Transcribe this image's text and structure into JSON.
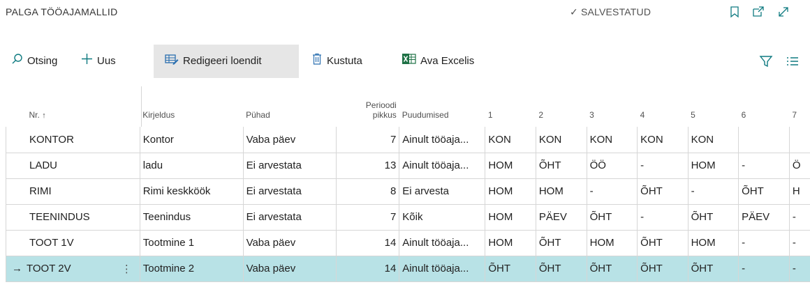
{
  "header": {
    "title": "PALGA TÖÖAJAMALLID",
    "saved_check": "✓",
    "saved_label": "SALVESTATUD"
  },
  "actions": {
    "search": "Otsing",
    "new": "Uus",
    "edit_list": "Redigeeri loendit",
    "delete": "Kustuta",
    "open_excel": "Ava Excelis"
  },
  "columns": {
    "nr": "Nr.",
    "sort_arrow": "↑",
    "description": "Kirjeldus",
    "holidays": "Pühad",
    "period_line1": "Perioodi",
    "period_line2": "pikkus",
    "absences": "Puudumised",
    "d1": "1",
    "d2": "2",
    "d3": "3",
    "d4": "4",
    "d5": "5",
    "d6": "6",
    "d7": "7"
  },
  "rows": [
    {
      "nr": "KONTOR",
      "desc": "Kontor",
      "holidays": "Vaba päev",
      "period": "7",
      "absences": "Ainult tööaja...",
      "d1": "KON",
      "d2": "KON",
      "d3": "KON",
      "d4": "KON",
      "d5": "KON",
      "d6": "",
      "d7": ""
    },
    {
      "nr": "LADU",
      "desc": "ladu",
      "holidays": "Ei arvestata",
      "period": "13",
      "absences": "Ainult tööaja...",
      "d1": "HOM",
      "d2": "ÕHT",
      "d3": "ÖÖ",
      "d4": "-",
      "d5": "HOM",
      "d6": "-",
      "d7": "Ö"
    },
    {
      "nr": "RIMI",
      "desc": "Rimi keskköök",
      "holidays": "Ei arvestata",
      "period": "8",
      "absences": "Ei arvesta",
      "d1": "HOM",
      "d2": "HOM",
      "d3": "-",
      "d4": "ÕHT",
      "d5": "-",
      "d6": "ÕHT",
      "d7": "H"
    },
    {
      "nr": "TEENINDUS",
      "desc": "Teenindus",
      "holidays": "Ei arvestata",
      "period": "7",
      "absences": "Kõik",
      "d1": "HOM",
      "d2": "PÄEV",
      "d3": "ÕHT",
      "d4": "-",
      "d5": "ÕHT",
      "d6": "PÄEV",
      "d7": "-"
    },
    {
      "nr": "TOOT 1V",
      "desc": "Tootmine 1",
      "holidays": "Vaba päev",
      "period": "14",
      "absences": "Ainult tööaja...",
      "d1": "HOM",
      "d2": "ÕHT",
      "d3": "HOM",
      "d4": "ÕHT",
      "d5": "HOM",
      "d6": "-",
      "d7": "-"
    },
    {
      "nr": "TOOT 2V",
      "desc": "Tootmine 2",
      "holidays": "Vaba päev",
      "period": "14",
      "absences": "Ainult tööaja...",
      "d1": "ÕHT",
      "d2": "ÕHT",
      "d3": "ÕHT",
      "d4": "ÕHT",
      "d5": "ÕHT",
      "d6": "-",
      "d7": "-",
      "selected": true
    }
  ],
  "selection": {
    "arrow": "→",
    "menu_dots": "⋮"
  },
  "icons": [
    "search-icon",
    "plus-icon",
    "edit-list-icon",
    "trash-icon",
    "excel-icon",
    "bookmark-icon",
    "open-new-window-icon",
    "expand-icon",
    "filter-icon",
    "list-icon"
  ],
  "colors": {
    "accent": "#0e7a80",
    "selected_row": "#b8e2e6"
  }
}
